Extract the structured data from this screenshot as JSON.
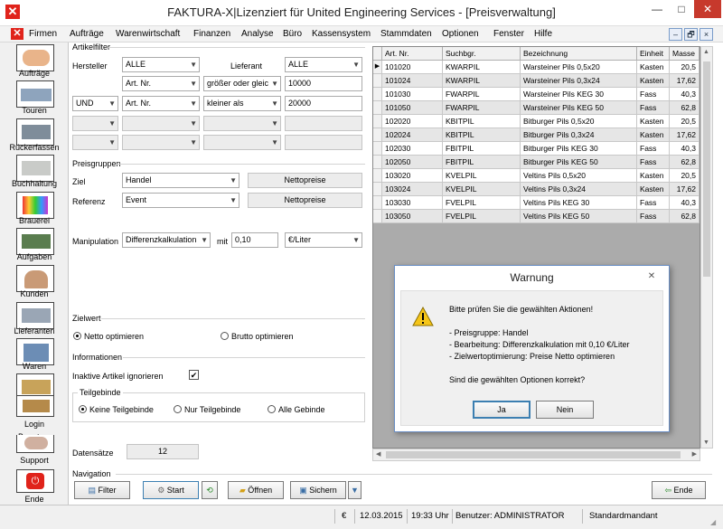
{
  "window": {
    "title": "FAKTURA-X|Lizenziert für United Engineering Services - [Preisverwaltung]",
    "logo": "✕",
    "minimize": "—",
    "maximize": "□",
    "close": "✕"
  },
  "menu": {
    "items": [
      "Firmen",
      "Aufträge",
      "Warenwirtschaft",
      "Finanzen",
      "Analyse",
      "Büro",
      "Kassensystem",
      "Stammdaten",
      "Optionen",
      "Fenster",
      "Hilfe"
    ],
    "mdi_buttons": [
      "–",
      "🗗",
      "×"
    ]
  },
  "nav": {
    "items": [
      "Aufträge",
      "Touren",
      "Rückerfassen",
      "Buchhaltung",
      "Brauerei",
      "Aufgaben",
      "Kunden",
      "Lieferanten",
      "Waren",
      "Login",
      "Benutzer",
      "Support",
      "Ende"
    ]
  },
  "artikelfilter": {
    "title": "Artikelfilter",
    "hersteller_label": "Hersteller",
    "hersteller_value": "ALLE",
    "lieferant_label": "Lieferant",
    "lieferant_value": "ALLE",
    "row1": {
      "field": "Art. Nr.",
      "operator": "größer oder gleic",
      "value": "10000"
    },
    "row2": {
      "logic": "UND",
      "field": "Art. Nr.",
      "operator": "kleiner als",
      "value": "20000"
    }
  },
  "preisgruppen": {
    "title": "Preisgruppen",
    "ziel_label": "Ziel",
    "ziel_value": "Handel",
    "ziel_type": "Nettopreise",
    "referenz_label": "Referenz",
    "referenz_value": "Event",
    "referenz_type": "Nettopreise",
    "manipulation_label": "Manipulation",
    "manipulation_value": "Differenzkalkulation",
    "mit_label": "mit",
    "mit_value": "0,10",
    "unit_value": "€/Liter"
  },
  "zielwert": {
    "title": "Zielwert",
    "netto": "Netto optimieren",
    "brutto": "Brutto optimieren",
    "selected": "netto"
  },
  "informationen": {
    "title": "Informationen",
    "inaktive_label": "Inaktive Artikel ignorieren",
    "inaktive_checked": true,
    "check": "✔",
    "teilgebinde_title": "Teilgebinde",
    "options": [
      "Keine Teilgebinde",
      "Nur Teilgebinde",
      "Alle Gebinde"
    ],
    "selected": "Keine Teilgebinde"
  },
  "datensaetze": {
    "label": "Datensätze",
    "value": "12"
  },
  "navigation": {
    "title": "Navigation",
    "filter": "Filter",
    "start": "Start",
    "oeffnen": "Öffnen",
    "sichern": "Sichern",
    "ende": "Ende"
  },
  "table": {
    "columns": [
      "Art. Nr.",
      "Suchbgr.",
      "Bezeichnung",
      "Einheit",
      "Masse"
    ],
    "rows": [
      [
        "101020",
        "KWARPIL",
        "Warsteiner Pils 0,5x20",
        "Kasten",
        "20,5"
      ],
      [
        "101024",
        "KWARPIL",
        "Warsteiner Pils 0,3x24",
        "Kasten",
        "17,62"
      ],
      [
        "101030",
        "FWARPIL",
        "Warsteiner Pils KEG 30",
        "Fass",
        "40,3"
      ],
      [
        "101050",
        "FWARPIL",
        "Warsteiner Pils KEG 50",
        "Fass",
        "62,8"
      ],
      [
        "102020",
        "KBITPIL",
        "Bitburger Pils 0,5x20",
        "Kasten",
        "20,5"
      ],
      [
        "102024",
        "KBITPIL",
        "Bitburger Pils 0,3x24",
        "Kasten",
        "17,62"
      ],
      [
        "102030",
        "FBITPIL",
        "Bitburger Pils KEG 30",
        "Fass",
        "40,3"
      ],
      [
        "102050",
        "FBITPIL",
        "Bitburger Pils KEG 50",
        "Fass",
        "62,8"
      ],
      [
        "103020",
        "KVELPIL",
        "Veltins Pils 0,5x20",
        "Kasten",
        "20,5"
      ],
      [
        "103024",
        "KVELPIL",
        "Veltins Pils 0,3x24",
        "Kasten",
        "17,62"
      ],
      [
        "103030",
        "FVELPIL",
        "Veltins Pils KEG 30",
        "Fass",
        "40,3"
      ],
      [
        "103050",
        "FVELPIL",
        "Veltins Pils KEG 50",
        "Fass",
        "62,8"
      ]
    ]
  },
  "dialog": {
    "title": "Warnung",
    "message": "Bitte prüfen Sie die gewählten Aktionen!",
    "lines": [
      "- Preisgruppe: Handel",
      "- Bearbeitung: Differenzkalkulation mit 0,10 €/Liter",
      "- Zielwertoptimierung: Preise Netto optimieren"
    ],
    "question": "Sind die gewählten Optionen korrekt?",
    "yes": "Ja",
    "no": "Nein",
    "close": "✕"
  },
  "status": {
    "currency": "€",
    "date": "12.03.2015",
    "time": "19:33 Uhr",
    "user": "Benutzer: ADMINISTRATOR",
    "mandant": "Standardmandant"
  }
}
